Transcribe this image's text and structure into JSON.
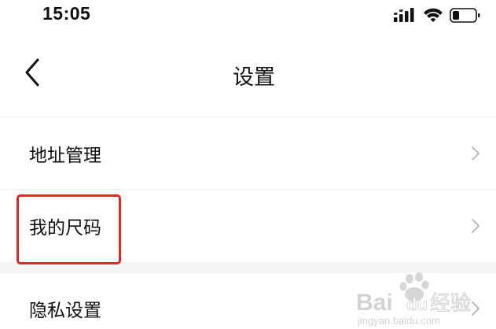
{
  "status_bar": {
    "time": "15:05",
    "icons": [
      "signal-icon",
      "wifi-icon",
      "battery-icon"
    ]
  },
  "nav": {
    "title": "设置",
    "back_icon": "chevron-left-icon"
  },
  "settings": {
    "items": [
      {
        "label": "地址管理",
        "icon": "chevron-right-icon"
      },
      {
        "label": "我的尺码",
        "icon": "chevron-right-icon",
        "highlighted": true
      },
      {
        "label": "隐私设置",
        "icon": "chevron-right-icon"
      }
    ]
  },
  "annotation": {
    "highlight_color": "#e8261f"
  },
  "watermark": {
    "text_main": "Bai",
    "text_du": "du",
    "text_jingyan": "经验",
    "text_url": "jingyan.baidu.com"
  }
}
